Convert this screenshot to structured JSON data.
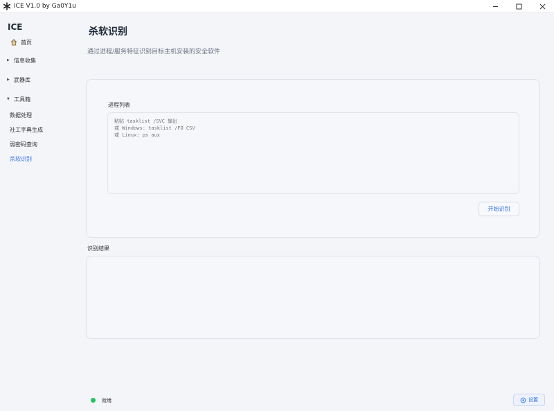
{
  "window": {
    "title": "ICE V1.0 by Ga0Y1u",
    "minimize": "—",
    "maximize": "☐",
    "close": "✕"
  },
  "sidebar": {
    "brand": "ICE",
    "home": "首页",
    "groups": [
      {
        "label": "信息收集",
        "expanded": false
      },
      {
        "label": "武器库",
        "expanded": false
      },
      {
        "label": "工具箱",
        "expanded": true
      }
    ],
    "toolbox_items": [
      "数据处理",
      "社工字典生成",
      "弱密码查询",
      "杀软识别"
    ],
    "active_item": "杀软识别"
  },
  "main": {
    "title": "杀软识别",
    "subtitle": "通过进程/服务特征识别目标主机安装的安全软件",
    "process_list_label": "进程列表",
    "process_list_placeholder": "粘贴 tasklist /SVC 输出\n或 Windows: tasklist /FO CSV\n或 Linux: ps aux",
    "start_button": "开始识别",
    "result_label": "识别结果"
  },
  "status": {
    "text": "就绪",
    "color": "#22c55e",
    "settings_button": "设置"
  },
  "colors": {
    "accent": "#2f6fed",
    "background": "#f4f5f9"
  }
}
